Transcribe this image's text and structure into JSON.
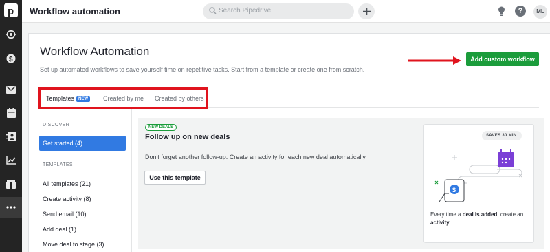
{
  "app": {
    "title": "Workflow automation",
    "search_placeholder": "Search Pipedrive",
    "avatar_initials": "ML",
    "help_symbol": "?"
  },
  "page": {
    "title": "Workflow Automation",
    "subtitle": "Set up automated workflows to save yourself time on repetitive tasks. Start from a template or create one from scratch.",
    "add_button": "Add custom workflow"
  },
  "tabs": [
    {
      "label": "Templates",
      "badge": "NEW",
      "active": true
    },
    {
      "label": "Created by me"
    },
    {
      "label": "Created by others"
    }
  ],
  "sidebar": {
    "discover_heading": "DISCOVER",
    "get_started": "Get started (4)",
    "templates_heading": "TEMPLATES",
    "items": [
      "All templates (21)",
      "Create activity (8)",
      "Send email (10)",
      "Add deal (1)",
      "Move deal to stage (3)"
    ]
  },
  "template": {
    "tag": "NEW DEALS",
    "title": "Follow up on new deals",
    "description": "Don't forget another follow-up. Create an activity for each new deal automatically.",
    "button": "Use this template",
    "saves": "SAVES 30 MIN.",
    "caption_prefix": "Every time a ",
    "caption_bold1": "deal is added",
    "caption_mid": ", create an ",
    "caption_bold2": "activity"
  },
  "colors": {
    "accent_blue": "#317ae2",
    "brand_green": "#1b9c3b",
    "annotation_red": "#e0141e",
    "rail": "#242424",
    "calendar_purple": "#7b3fd6"
  }
}
